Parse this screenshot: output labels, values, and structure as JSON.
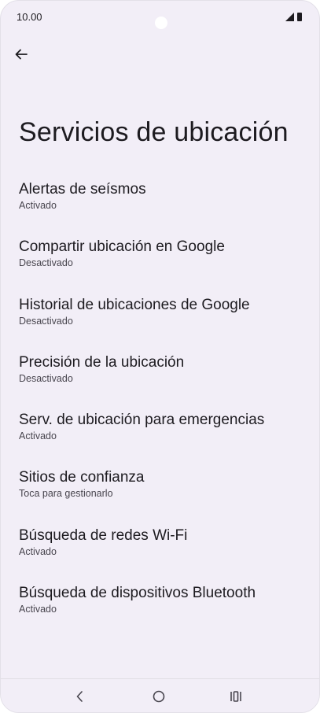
{
  "status_bar": {
    "time": "10.00"
  },
  "header": {
    "title": "Servicios de ubicación"
  },
  "settings": {
    "items": [
      {
        "label": "Alertas de seísmos",
        "status": "Activado"
      },
      {
        "label": "Compartir ubicación en Google",
        "status": "Desactivado"
      },
      {
        "label": "Historial de ubicaciones de Google",
        "status": "Desactivado"
      },
      {
        "label": "Precisión de la ubicación",
        "status": "Desactivado"
      },
      {
        "label": "Serv. de ubicación para emergencias",
        "status": "Activado"
      },
      {
        "label": "Sitios de confianza",
        "status": "Toca para gestionarlo"
      },
      {
        "label": "Búsqueda de redes Wi-Fi",
        "status": "Activado"
      },
      {
        "label": "Búsqueda de dispositivos Bluetooth",
        "status": "Activado"
      }
    ]
  },
  "icons": {
    "back": "arrow-back-icon",
    "nav_back": "chevron-left-icon",
    "nav_home": "circle-home-icon",
    "nav_recents": "recents-icon",
    "signal": "signal-icon",
    "battery": "battery-icon"
  },
  "colors": {
    "background": "#f2eef7",
    "text_primary": "#1d1b20",
    "text_secondary": "#48454e"
  }
}
